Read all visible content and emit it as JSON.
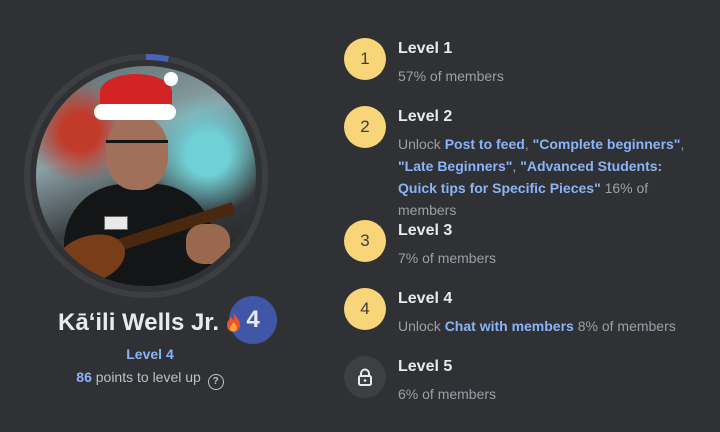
{
  "profile": {
    "name": "Kāʻili Wells Jr.",
    "level_badge": "4",
    "level_label": "Level 4",
    "points": "86",
    "points_suffix": "points to level up",
    "help_glyph": "?",
    "progress_fraction": 0.03,
    "ring_color": "#4a63b8",
    "flame_icon": "fire-icon"
  },
  "levels": [
    {
      "num": "1",
      "title": "Level 1",
      "pct": "57% of members"
    },
    {
      "num": "2",
      "title": "Level 2",
      "unlock": "Unlock",
      "links": [
        "Post to feed",
        "\"Complete beginners\"",
        "\"Late Beginners\"",
        "\"Advanced Students: Quick tips for Specific Pieces\""
      ],
      "pct": "16% of members"
    },
    {
      "num": "3",
      "title": "Level 3",
      "pct": "7% of members"
    },
    {
      "num": "4",
      "title": "Level 4",
      "unlock": "Unlock",
      "links": [
        "Chat with members"
      ],
      "pct": "8% of members"
    },
    {
      "num": "",
      "title": "Level 5",
      "pct": "6% of members",
      "locked_icon": "lock-icon"
    }
  ],
  "colors": {
    "background": "#303134",
    "level_circle": "#f9d57a",
    "link": "#8ab4f8"
  }
}
